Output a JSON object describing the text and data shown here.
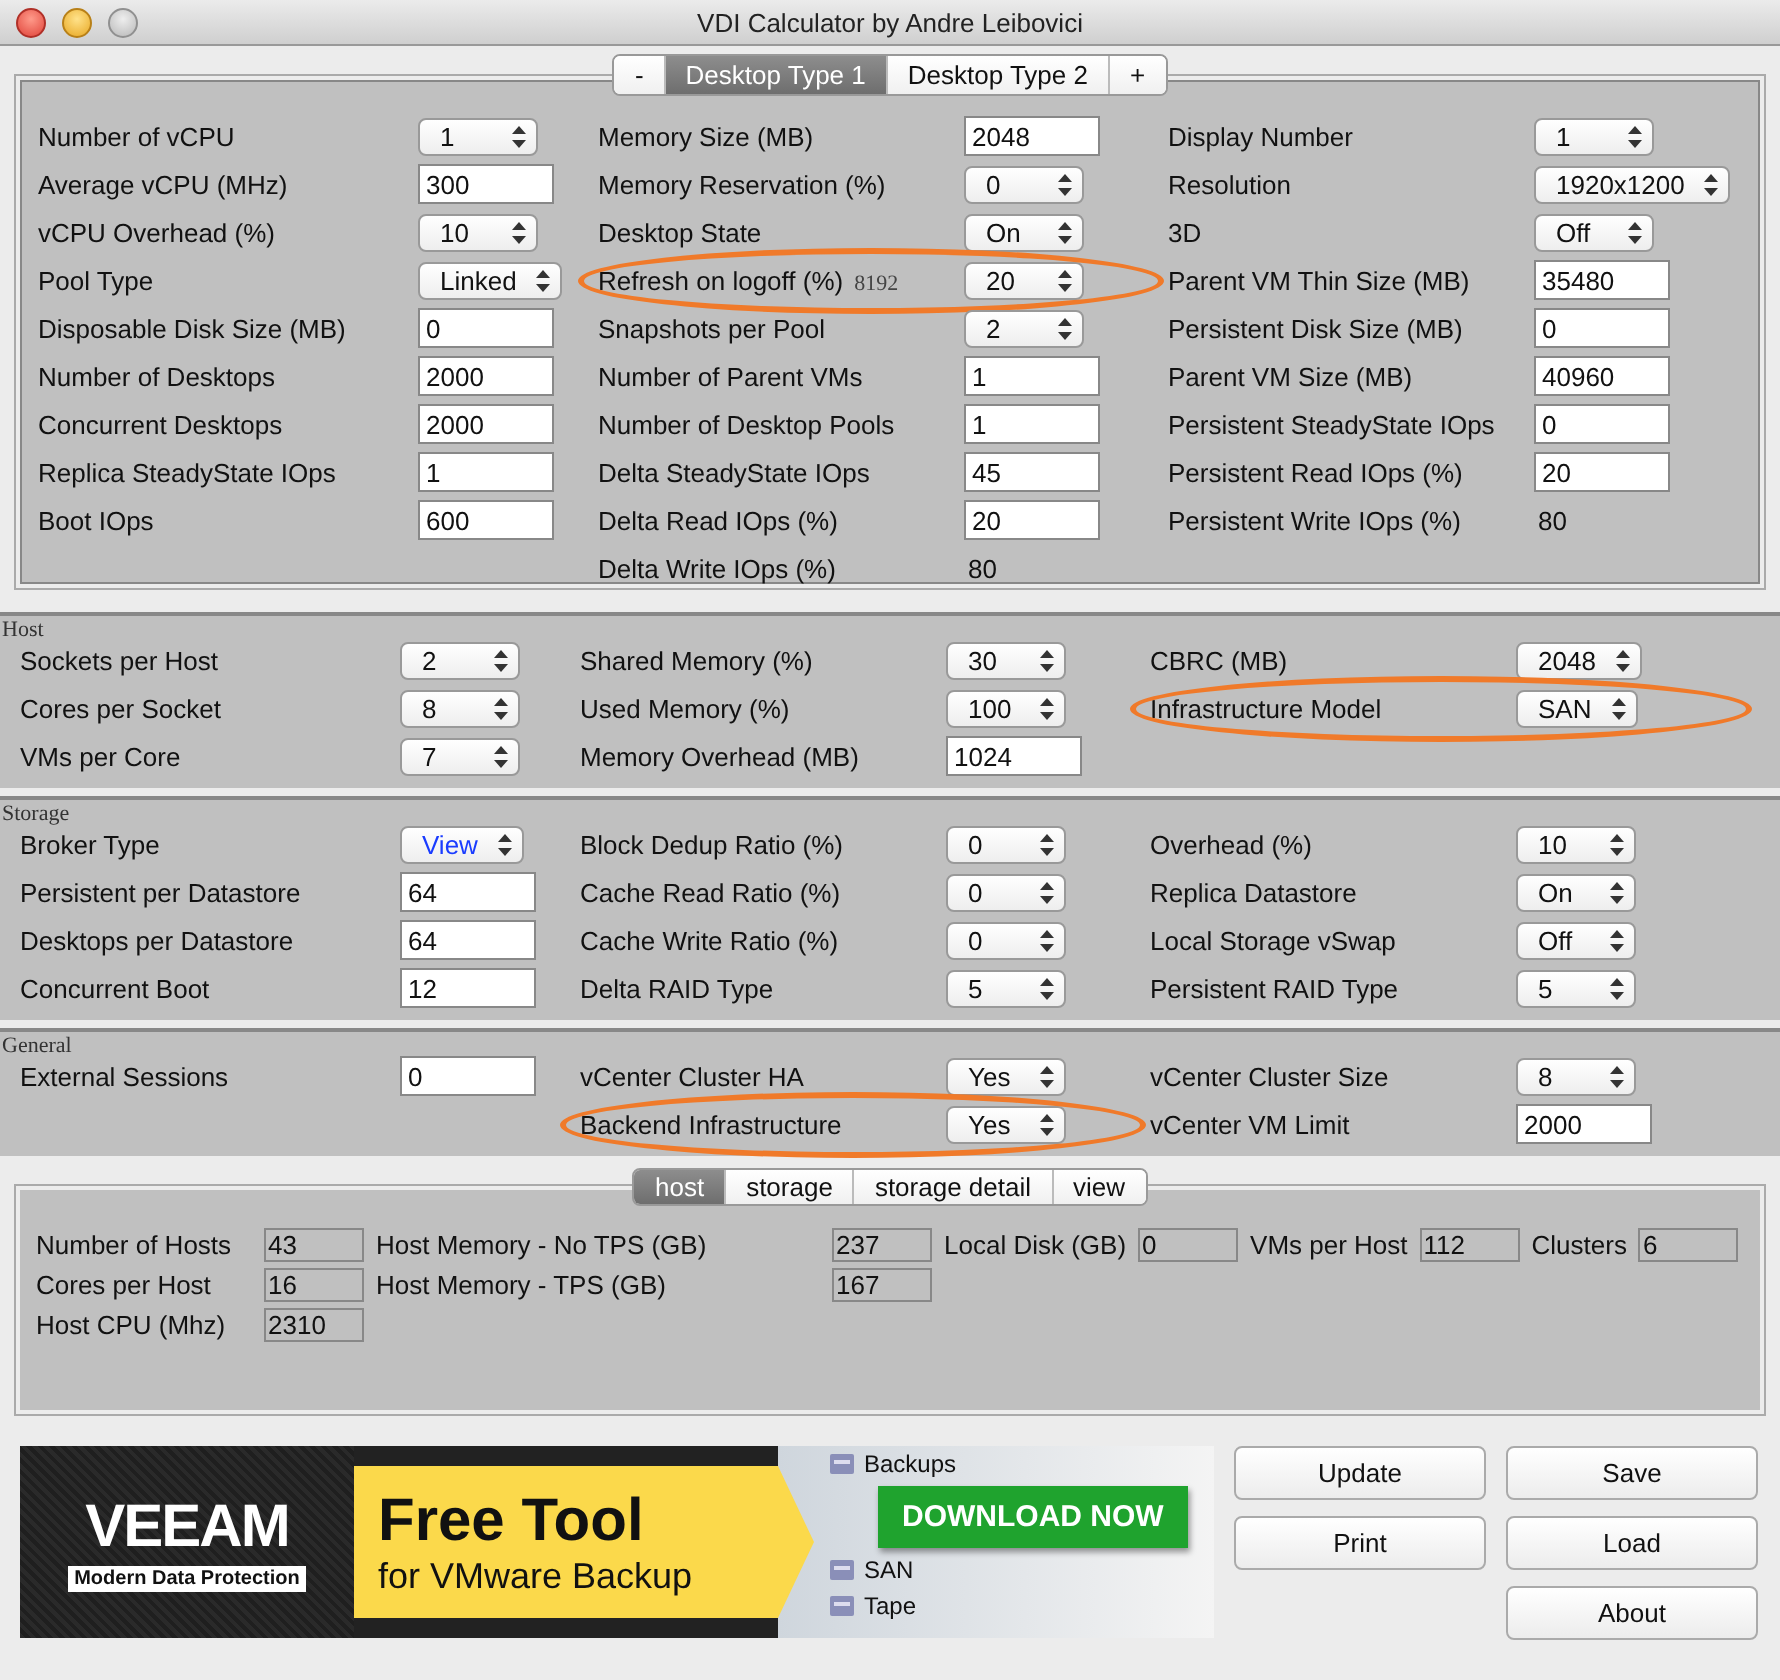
{
  "window": {
    "title": "VDI Calculator by Andre Leibovici"
  },
  "desktop_tabs": [
    {
      "label": "-",
      "selected": false
    },
    {
      "label": "Desktop Type 1",
      "selected": true
    },
    {
      "label": "Desktop Type 2",
      "selected": false
    },
    {
      "label": "+",
      "selected": false
    }
  ],
  "sections": [
    {
      "columns": [
        [
          {
            "label": "Number of vCPU",
            "value": "1",
            "kind": "select"
          },
          {
            "label": "Average vCPU (MHz)",
            "value": "300",
            "kind": "input"
          },
          {
            "label": "vCPU Overhead (%)",
            "value": "10",
            "kind": "select"
          },
          {
            "label": "Pool Type",
            "value": "Linked",
            "kind": "select"
          },
          {
            "label": "Disposable Disk Size (MB)",
            "value": "0",
            "kind": "input"
          },
          {
            "label": "Number of Desktops",
            "value": "2000",
            "kind": "input"
          },
          {
            "label": "Concurrent Desktops",
            "value": "2000",
            "kind": "input"
          },
          {
            "label": "Replica SteadyState IOps",
            "value": "1",
            "kind": "input"
          },
          {
            "label": "Boot IOps",
            "value": "600",
            "kind": "input"
          }
        ],
        [
          {
            "label": "Memory Size (MB)",
            "value": "2048",
            "kind": "input"
          },
          {
            "label": "Memory Reservation (%)",
            "value": "0",
            "kind": "select"
          },
          {
            "label": "Desktop State",
            "value": "On",
            "kind": "select"
          },
          {
            "label": "Refresh on logoff (%)",
            "note": "8192",
            "value": "20",
            "kind": "select",
            "highlighted": true
          },
          {
            "label": "Snapshots per Pool",
            "value": "2",
            "kind": "select"
          },
          {
            "label": "Number of Parent VMs",
            "value": "1",
            "kind": "input"
          },
          {
            "label": "Number of Desktop Pools",
            "value": "1",
            "kind": "input"
          },
          {
            "label": "Delta SteadyState IOps",
            "value": "45",
            "kind": "input"
          },
          {
            "label": "Delta Read IOps (%)",
            "value": "20",
            "kind": "input"
          },
          {
            "label": "Delta Write IOps (%)",
            "value": "80",
            "kind": "text"
          }
        ],
        [
          {
            "label": "Display Number",
            "value": "1",
            "kind": "select"
          },
          {
            "label": "Resolution",
            "value": "1920x1200",
            "kind": "select"
          },
          {
            "label": "3D",
            "value": "Off",
            "kind": "select"
          },
          {
            "label": "Parent VM Thin Size (MB)",
            "value": "35480",
            "kind": "input"
          },
          {
            "label": "Persistent Disk Size (MB)",
            "value": "0",
            "kind": "input"
          },
          {
            "label": "Parent VM Size (MB)",
            "value": "40960",
            "kind": "input"
          },
          {
            "label": "Persistent SteadyState IOps",
            "value": "0",
            "kind": "input"
          },
          {
            "label": "Persistent Read IOps (%)",
            "value": "20",
            "kind": "input"
          },
          {
            "label": "Persistent Write IOps (%)",
            "value": "80",
            "kind": "text"
          }
        ]
      ]
    },
    {
      "title": "Host",
      "columns": [
        [
          {
            "label": "Sockets per Host",
            "value": "2",
            "kind": "select"
          },
          {
            "label": "Cores per Socket",
            "value": "8",
            "kind": "select"
          },
          {
            "label": "VMs per Core",
            "value": "7",
            "kind": "select"
          }
        ],
        [
          {
            "label": "Shared Memory (%)",
            "value": "30",
            "kind": "select"
          },
          {
            "label": "Used Memory (%)",
            "value": "100",
            "kind": "select"
          },
          {
            "label": "Memory Overhead (MB)",
            "value": "1024",
            "kind": "input"
          }
        ],
        [
          {
            "label": "CBRC (MB)",
            "value": "2048",
            "kind": "select"
          },
          {
            "label": "Infrastructure Model",
            "value": "SAN",
            "kind": "select",
            "highlighted": true
          }
        ]
      ]
    },
    {
      "title": "Storage",
      "columns": [
        [
          {
            "label": "Broker Type",
            "value": "View",
            "kind": "select",
            "accent": true
          },
          {
            "label": "Persistent per Datastore",
            "value": "64",
            "kind": "input"
          },
          {
            "label": "Desktops per Datastore",
            "value": "64",
            "kind": "input"
          },
          {
            "label": "Concurrent Boot",
            "value": "12",
            "kind": "input"
          }
        ],
        [
          {
            "label": "Block Dedup Ratio (%)",
            "value": "0",
            "kind": "select"
          },
          {
            "label": "Cache Read Ratio (%)",
            "value": "0",
            "kind": "select"
          },
          {
            "label": "Cache Write Ratio (%)",
            "value": "0",
            "kind": "select"
          },
          {
            "label": "Delta RAID Type",
            "value": "5",
            "kind": "select"
          }
        ],
        [
          {
            "label": "Overhead (%)",
            "value": "10",
            "kind": "select"
          },
          {
            "label": "Replica Datastore",
            "value": "On",
            "kind": "select"
          },
          {
            "label": "Local Storage vSwap",
            "value": "Off",
            "kind": "select"
          },
          {
            "label": "Persistent RAID Type",
            "value": "5",
            "kind": "select"
          }
        ]
      ]
    },
    {
      "title": "General",
      "columns": [
        [
          {
            "label": "External Sessions",
            "value": "0",
            "kind": "input"
          }
        ],
        [
          {
            "label": "vCenter Cluster HA",
            "value": "Yes",
            "kind": "select"
          },
          {
            "label": "Backend Infrastructure",
            "value": "Yes",
            "kind": "select",
            "highlighted": true
          }
        ],
        [
          {
            "label": "vCenter Cluster Size",
            "value": "8",
            "kind": "select"
          },
          {
            "label": "vCenter VM Limit",
            "value": "2000",
            "kind": "input"
          }
        ]
      ]
    }
  ],
  "result_tabs": [
    {
      "label": "host",
      "selected": true
    },
    {
      "label": "storage",
      "selected": false
    },
    {
      "label": "storage detail",
      "selected": false
    },
    {
      "label": "view",
      "selected": false
    }
  ],
  "results": [
    [
      {
        "label": "Number of Hosts",
        "value": "43"
      },
      {
        "label": "Cores per Host",
        "value": "16"
      },
      {
        "label": "Host CPU (Mhz)",
        "value": "2310"
      }
    ],
    [
      {
        "label": "Host Memory - No TPS (GB)",
        "value": "237"
      },
      {
        "label": "Host Memory - TPS (GB)",
        "value": "167"
      }
    ],
    [
      {
        "label": "Local Disk (GB)",
        "value": "0"
      }
    ],
    [
      {
        "label": "VMs per Host",
        "value": "112"
      }
    ],
    [
      {
        "label": "Clusters",
        "value": "6"
      }
    ]
  ],
  "banner": {
    "logo": "VEEAM",
    "tagline": "Modern Data Protection",
    "headline": "Free Tool",
    "subline": "for VMware Backup",
    "button": "DOWNLOAD NOW",
    "list": [
      "Backups",
      "SAN",
      "Tape"
    ]
  },
  "buttons": [
    {
      "label": "Update"
    },
    {
      "label": "Save"
    },
    {
      "label": "Print"
    },
    {
      "label": "Load"
    },
    {
      "label": "About"
    }
  ]
}
